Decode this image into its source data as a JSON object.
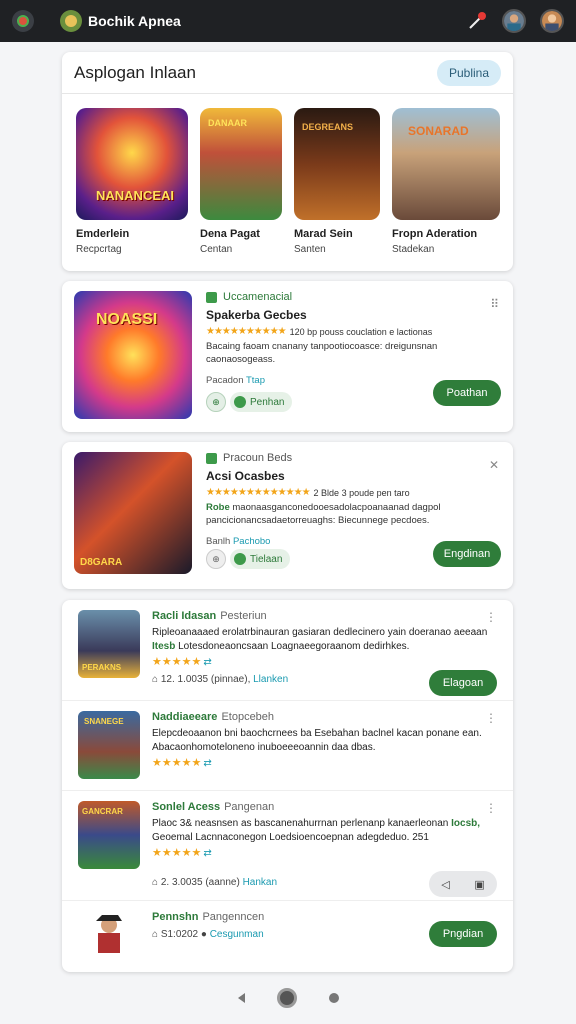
{
  "topbar": {
    "title": "Bochik Apnea",
    "icons": [
      "logo-icon",
      "app-icon",
      "pin-icon",
      "avatar",
      "avatar"
    ]
  },
  "header_card": {
    "title": "Asplogan Inlaan",
    "pill": "Publina",
    "games": [
      {
        "name": "Emderlein",
        "sub": "Recpcrtag"
      },
      {
        "name": "Dena Pagat",
        "sub": "Centan"
      },
      {
        "name": "Marad Sein",
        "sub": "Santen"
      },
      {
        "name": "Fropn Aderation",
        "sub": "Stadekan"
      }
    ]
  },
  "featured": [
    {
      "tag": "Uccamenacial",
      "title": "Spakerba Gecbes",
      "rating_text": "120 bp pouss couclation e lactionas",
      "desc": "Bacaing faoam cnanany tanpootiocoasce: dreigunsnan caonaosogeass.",
      "desc_green": "",
      "meta_left": "Pacadon",
      "meta_link": "Ttap",
      "chip_label": "Penhan",
      "button": "Poathan"
    },
    {
      "tag": "Pracoun Beds",
      "title": "Acsi Ocasbes",
      "rating_text": "2 Blde 3 poude pen taro",
      "desc": "maonaasganconedooesadolacpoanaanad dagpol pancicionancsadaetorreuaghs: Biecunnege pecdoes.",
      "desc_green": "Robe",
      "meta_left": "Banlh",
      "meta_link": "Pachobo",
      "chip_label": "Tielaan",
      "button": "Engdinan"
    }
  ],
  "list": [
    {
      "name": "Racli Idasan",
      "sub": "Pesteriun",
      "desc": "Ripleoanaaaed erolatrbinauran gasiaran dedlecinero yain doeranao aeeaan",
      "desc_green": "Itesb",
      "desc_tail": "Lotesdoneaoncsaan Loagnaeegoraanom dedirhkes.",
      "stars": "★★★★★",
      "meta_count": "12. 1.0035",
      "meta_label": "(pinnae),",
      "meta_link": "Llanken",
      "button": "Elagoan"
    },
    {
      "name": "Naddiaeeare",
      "sub": "Etopcebeh",
      "desc": "Elepcdeoaanon bni baochcrnees ba Esebahan baclnel kacan",
      "desc_green": "",
      "desc_tail": "ponane ean. Abacaonhomoteloneno inuboeeeoannin daa dbas.",
      "stars": "★★★★★",
      "meta_count": "",
      "meta_label": "",
      "meta_link": "",
      "button": ""
    },
    {
      "name": "Sonlel Acess",
      "sub": "Pangenan",
      "desc": "Plaoc 3& neasnsen as bascanenahurrnan perlenanp kanaerleonan",
      "desc_green": "Iocsb,",
      "desc_tail": "Geoemal Lacnnaconegon Loedsioencoepnan adegdeduo. 251",
      "stars": "★★★★★",
      "meta_count": "2. 3.0035",
      "meta_label": "(aanne)",
      "meta_link": "Hankan",
      "button": ""
    },
    {
      "name": "Pennshn",
      "sub": "Pangenncen",
      "desc": "",
      "desc_green": "",
      "desc_tail": "",
      "stars": "",
      "meta_count": "S1:0202",
      "meta_label": "",
      "meta_link": "Cesgunman",
      "button": "Pngdian"
    }
  ]
}
